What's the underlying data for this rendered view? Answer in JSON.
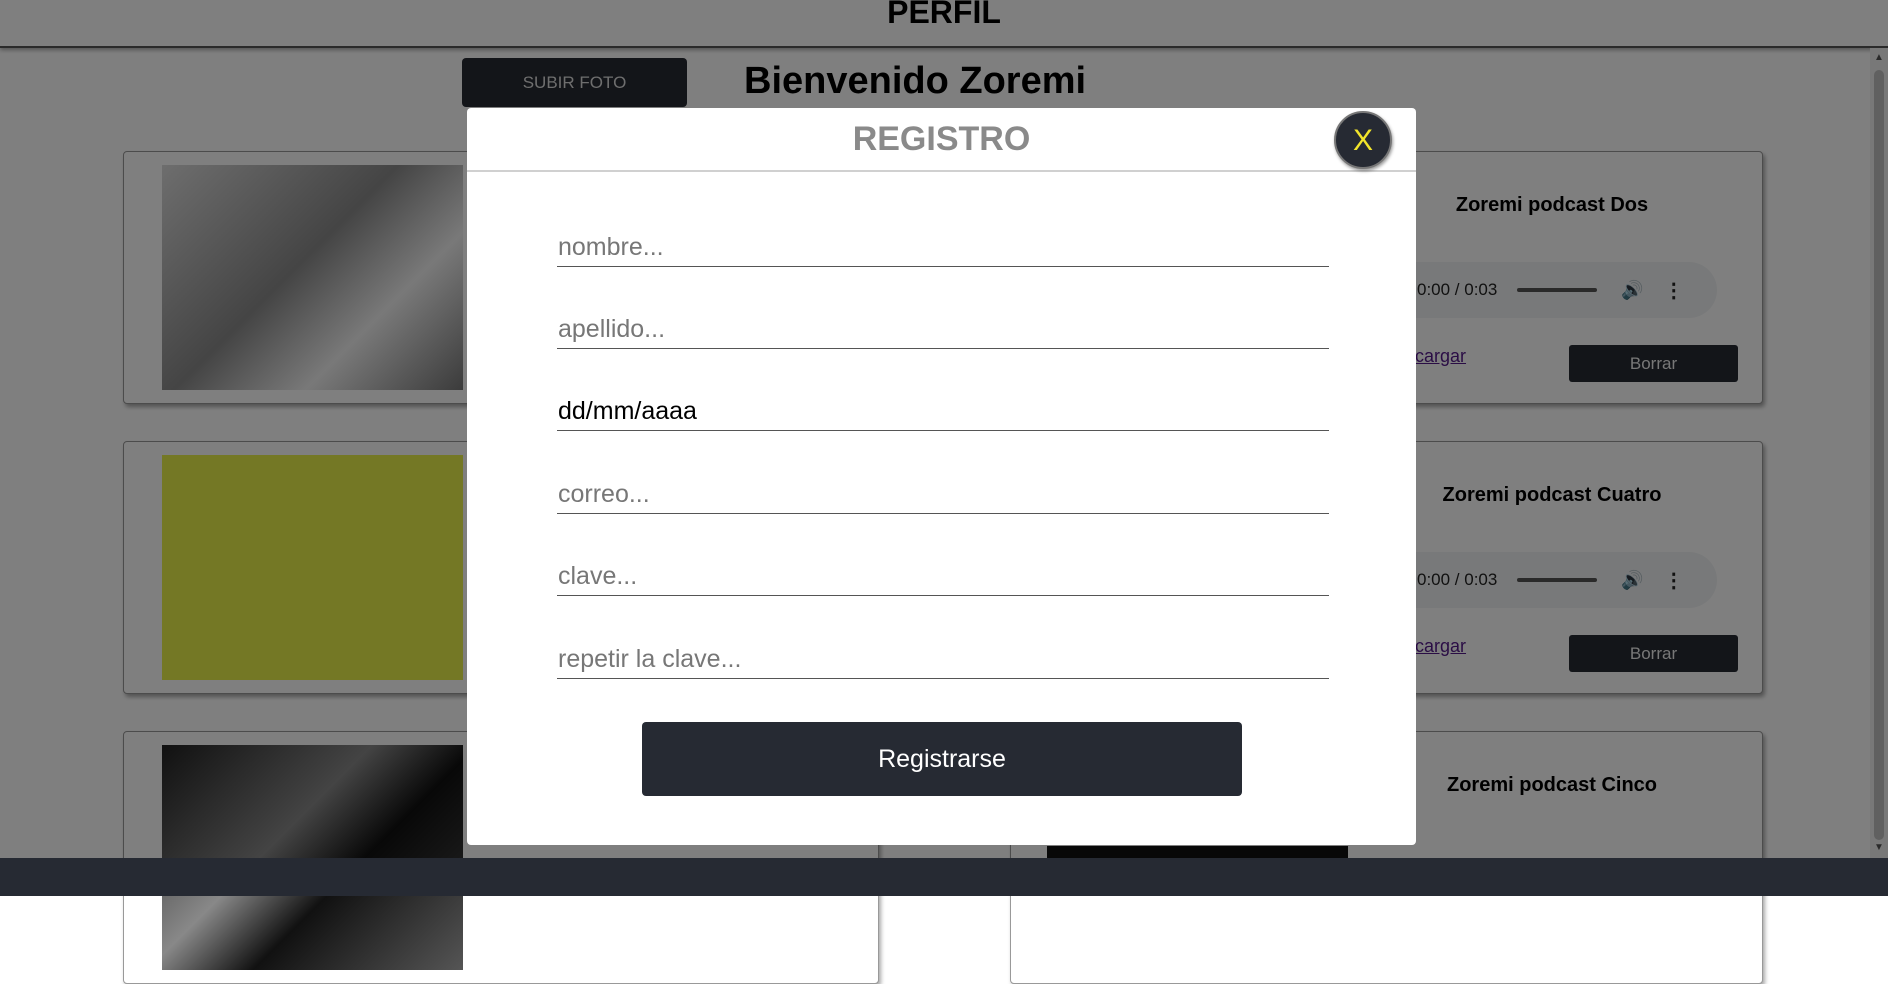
{
  "header": {
    "title": "PERFIL"
  },
  "profile": {
    "upload_label": "SUBIR FOTO",
    "welcome": "Bienvenido Zoremi"
  },
  "podcasts": [
    {
      "name": "Zoremi podcast Dos",
      "time": "0:00 / 0:03",
      "download_label": "cargar",
      "delete_label": "Borrar"
    },
    {
      "name": "Zoremi podcast Cuatro",
      "time": "0:00 / 0:03",
      "download_label": "cargar",
      "delete_label": "Borrar"
    },
    {
      "name": "Zoremi podcast Cinco"
    }
  ],
  "modal": {
    "title": "REGISTRO",
    "close_label": "X",
    "fields": {
      "nombre": {
        "placeholder": "nombre...",
        "value": ""
      },
      "apellido": {
        "placeholder": "apellido...",
        "value": ""
      },
      "fecha": {
        "value": "dd/mm/aaaa"
      },
      "correo": {
        "placeholder": "correo...",
        "value": ""
      },
      "clave": {
        "placeholder": "clave...",
        "value": ""
      },
      "repetir": {
        "placeholder": "repetir la clave...",
        "value": ""
      }
    },
    "submit_label": "Registrarse"
  },
  "icons": {
    "volume": "volume-icon",
    "more": "more-options-icon",
    "close": "close-icon"
  },
  "colors": {
    "dark": "#262a33",
    "close_text": "#f2e52b",
    "title_gray": "#8a8a8a"
  }
}
